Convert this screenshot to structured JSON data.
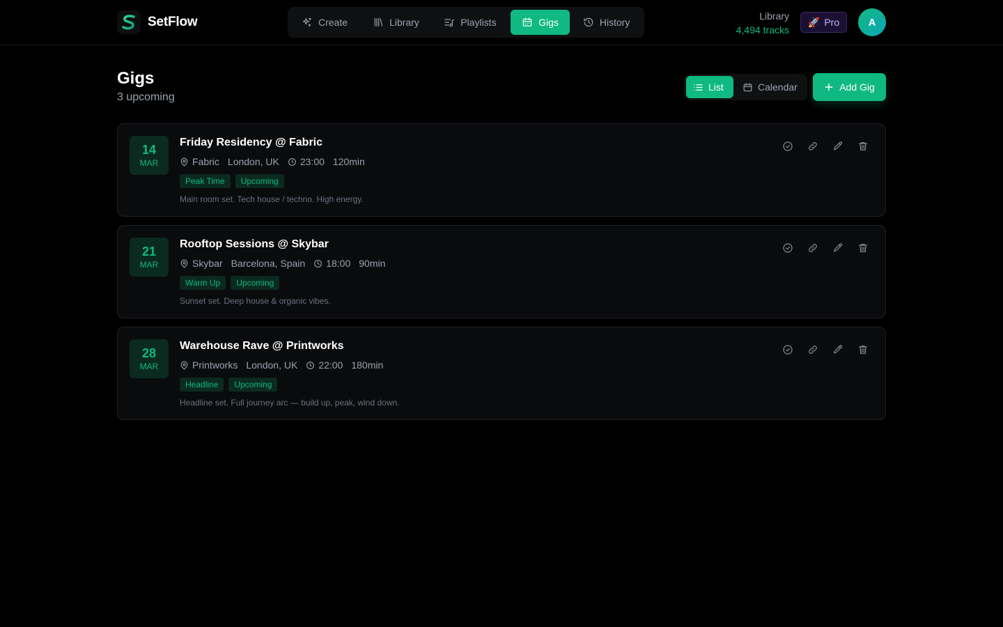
{
  "app": {
    "name": "SetFlow"
  },
  "nav": {
    "create": "Create",
    "library": "Library",
    "playlists": "Playlists",
    "gigs": "Gigs",
    "history": "History"
  },
  "library_stat": {
    "label": "Library",
    "value": "4,494 tracks"
  },
  "pro": {
    "label": "Pro"
  },
  "user": {
    "initial": "A"
  },
  "page": {
    "title": "Gigs",
    "subtitle": "3 upcoming"
  },
  "view": {
    "list": "List",
    "calendar": "Calendar"
  },
  "add_button": "Add Gig",
  "colors": {
    "accent": "#10b981",
    "background": "#000000",
    "card": "#0a0b0d"
  },
  "gigs": [
    {
      "day": "14",
      "month": "MAR",
      "title": "Friday Residency @ Fabric",
      "venue": "Fabric",
      "city": "London, UK",
      "time": "23:00",
      "duration": "120min",
      "tags": [
        "Peak Time",
        "Upcoming"
      ],
      "notes": "Main room set. Tech house / techno. High energy."
    },
    {
      "day": "21",
      "month": "MAR",
      "title": "Rooftop Sessions @ Skybar",
      "venue": "Skybar",
      "city": "Barcelona, Spain",
      "time": "18:00",
      "duration": "90min",
      "tags": [
        "Warm Up",
        "Upcoming"
      ],
      "notes": "Sunset set. Deep house & organic vibes."
    },
    {
      "day": "28",
      "month": "MAR",
      "title": "Warehouse Rave @ Printworks",
      "venue": "Printworks",
      "city": "London, UK",
      "time": "22:00",
      "duration": "180min",
      "tags": [
        "Headline",
        "Upcoming"
      ],
      "notes": "Headline set. Full journey arc — build up, peak, wind down."
    }
  ]
}
